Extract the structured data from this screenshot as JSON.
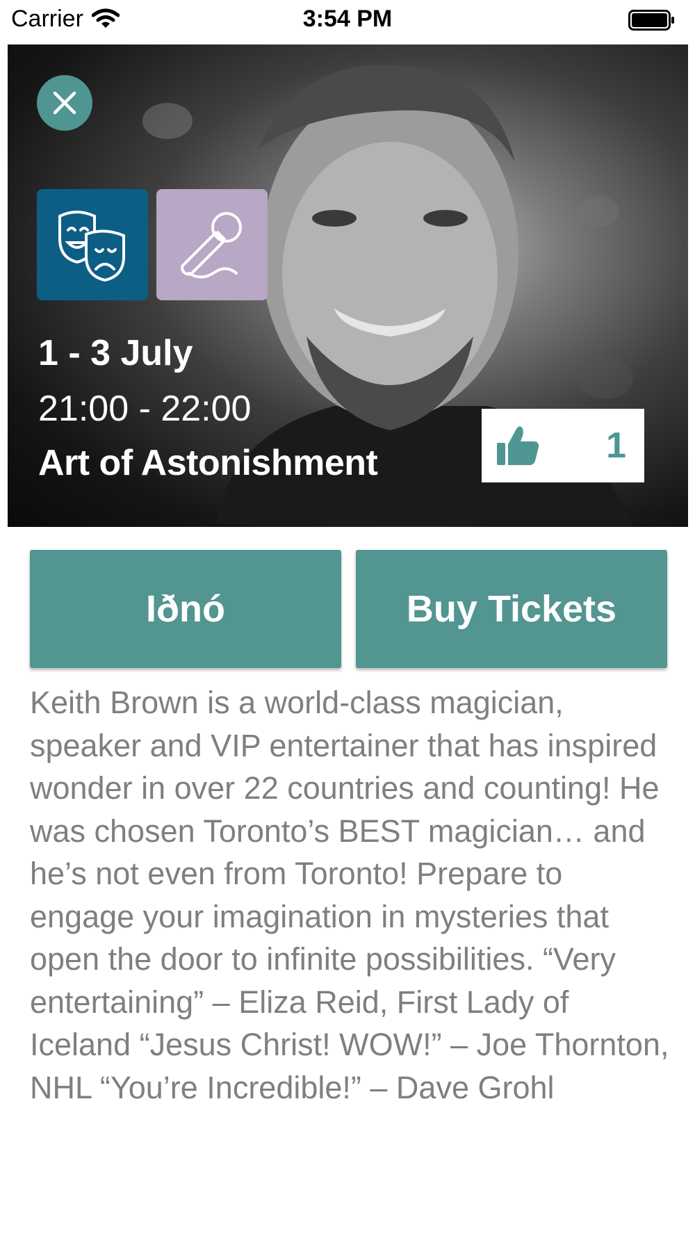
{
  "status_bar": {
    "carrier": "Carrier",
    "time": "3:54 PM",
    "icons": [
      "wifi-icon",
      "battery-icon"
    ]
  },
  "event": {
    "categories": [
      {
        "name": "theatre",
        "icon": "theatre-masks-icon",
        "color": "#0d5e85"
      },
      {
        "name": "music",
        "icon": "microphone-icon",
        "color": "#b9a7c6"
      }
    ],
    "date": "1 - 3 July",
    "time": "21:00 - 22:00",
    "title": "Art of Astonishment",
    "likes": "1",
    "like_icon": "thumbs-up-icon"
  },
  "actions": {
    "venue_label": "Iðnó",
    "tickets_label": "Buy Tickets"
  },
  "description": "Keith Brown is a world-class magician, speaker and VIP entertainer that has inspired wonder in over 22 countries and counting! He was chosen Toronto’s BEST magician… and he’s not even from Toronto! Prepare to engage your imagination in mysteries that open the door to infinite possibilities.   “Very entertaining” – Eliza Reid, First Lady of Iceland “Jesus Christ! WOW!” – Joe Thornton, NHL “You’re Incredible!” – Dave Grohl",
  "colors": {
    "accent": "#529591",
    "close_button": "#4f9692",
    "text_muted": "#7f7f7f"
  }
}
